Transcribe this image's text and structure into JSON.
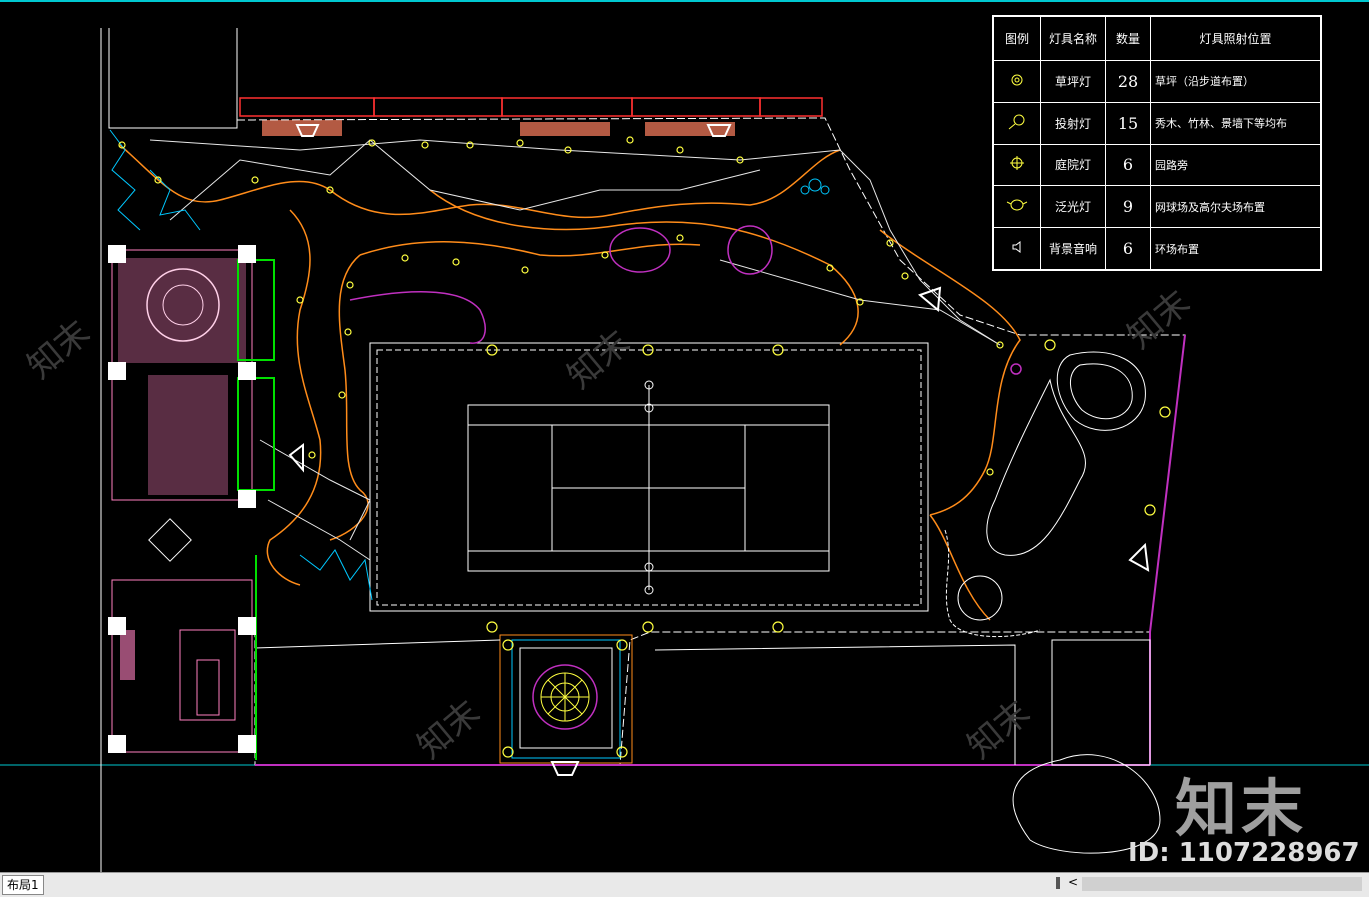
{
  "legend": {
    "headers": {
      "symbol": "图例",
      "name": "灯具名称",
      "qty": "数量",
      "location": "灯具照射位置"
    },
    "rows": [
      {
        "icon": "lawn-lamp-icon",
        "name": "草坪灯",
        "qty": "28",
        "location": "草坪（沿步道布置）"
      },
      {
        "icon": "spot-lamp-icon",
        "name": "投射灯",
        "qty": "15",
        "location": "秀木、竹林、景墙下等均布"
      },
      {
        "icon": "courtyard-lamp-icon",
        "name": "庭院灯",
        "qty": "6",
        "location": "园路旁"
      },
      {
        "icon": "flood-lamp-icon",
        "name": "泛光灯",
        "qty": "9",
        "location": "网球场及高尔夫场布置"
      },
      {
        "icon": "speaker-icon",
        "name": "背景音响",
        "qty": "6",
        "location": "环场布置"
      }
    ]
  },
  "watermark": {
    "logo": "知末",
    "id": "ID: 1107228967"
  },
  "statusbar": {
    "layout_tab": "布局1"
  },
  "colors": {
    "background": "#000000",
    "boundary_red": "#ff3030",
    "path_orange": "#ff8c1a",
    "plant_magenta": "#c030c0",
    "lamp_yellow": "#ffff40",
    "wall_green": "#00e000",
    "building_pink": "#ff80c0",
    "water_cyan": "#00c8ff"
  }
}
